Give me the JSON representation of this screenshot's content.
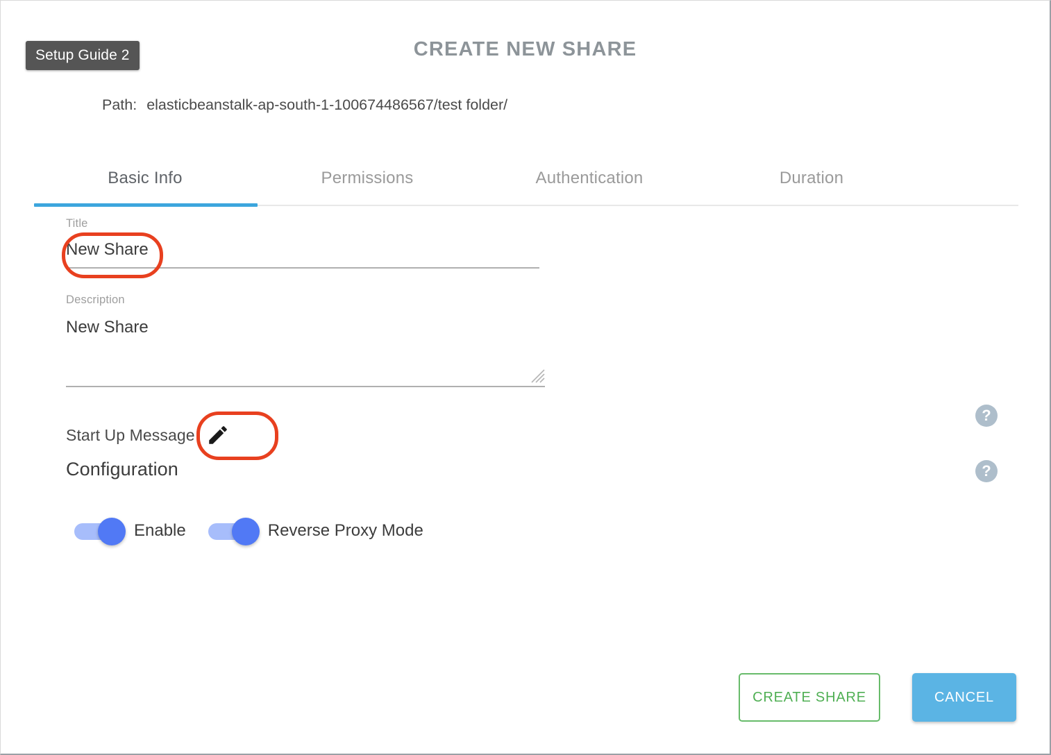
{
  "badge": {
    "label": "Setup Guide 2"
  },
  "dialog": {
    "title": "CREATE NEW SHARE"
  },
  "path": {
    "label": "Path:",
    "value": "elasticbeanstalk-ap-south-1-100674486567/test folder/"
  },
  "tabs": [
    {
      "label": "Basic Info",
      "active": true
    },
    {
      "label": "Permissions",
      "active": false
    },
    {
      "label": "Authentication",
      "active": false
    },
    {
      "label": "Duration",
      "active": false
    }
  ],
  "form": {
    "title_field": {
      "label": "Title",
      "value": "New Share"
    },
    "description_field": {
      "label": "Description",
      "value": "New Share",
      "resize_handle": "resize-handle-icon"
    },
    "startup_message": {
      "label": "Start Up Message",
      "edit_icon": "pencil-icon"
    },
    "configuration": {
      "heading": "Configuration",
      "toggles": [
        {
          "label": "Enable",
          "on": true
        },
        {
          "label": "Reverse Proxy Mode",
          "on": true
        }
      ]
    }
  },
  "help_icons": [
    {
      "name": "help-icon-startup-message",
      "glyph": "?"
    },
    {
      "name": "help-icon-configuration",
      "glyph": "?"
    }
  ],
  "footer": {
    "create_label": "CREATE SHARE",
    "cancel_label": "CANCEL"
  },
  "colors": {
    "badge_bg": "#555555",
    "title_text": "#8d9499",
    "tab_active_indicator": "#3ca6dd",
    "tab_inactive_text": "#9a9a9a",
    "toggle_track": "#a7bdfb",
    "toggle_knob": "#5179f5",
    "help_icon_bg": "#aebecb",
    "create_border": "#67bb6a",
    "create_text": "#4faf53",
    "cancel_bg": "#5bb4e4",
    "annotation": "#e8401f"
  },
  "annotations": [
    {
      "name": "annotation-title-value",
      "target": "title-value"
    },
    {
      "name": "annotation-startup-pencil",
      "target": "pencil-button"
    }
  ]
}
